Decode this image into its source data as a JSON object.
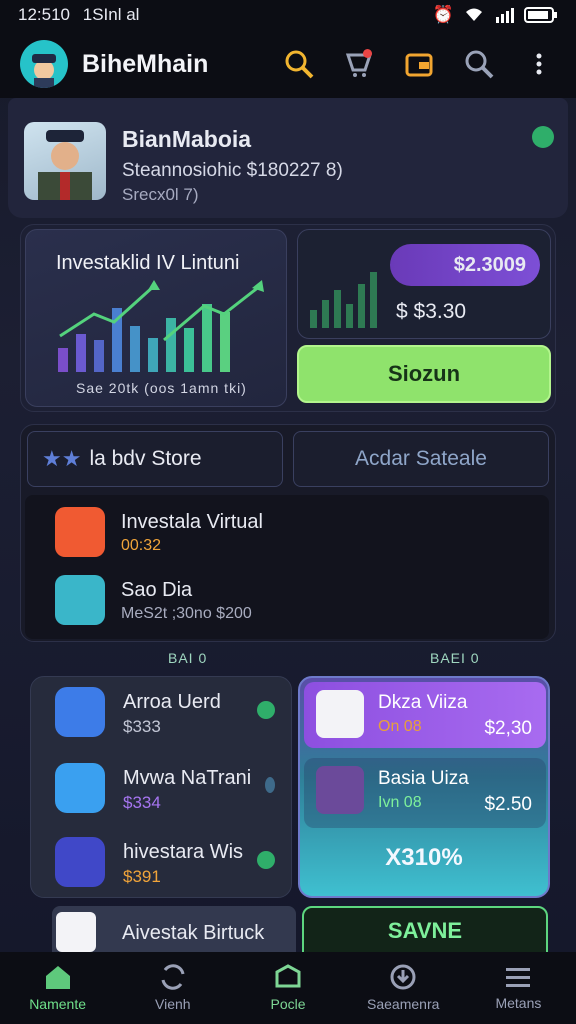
{
  "status_bar": {
    "time": "12:510",
    "carrier": "1SInl al"
  },
  "header": {
    "title": "BiheMhain"
  },
  "profile": {
    "name": "BianMaboia",
    "line1": "Steannosiohic $180227 8)",
    "line2": "Srecx0l 7)"
  },
  "investment": {
    "chart_title": "Investaklid IV Lintuni",
    "chart_caption": "Sae 20tk (oos 1amn tki)",
    "price_badge": "$2.3009",
    "price_sub": "$ $3.30",
    "action_button": "Siozun"
  },
  "store": {
    "tab_left": "la bdv Store",
    "tab_right": "Acdar Sateale",
    "items": [
      {
        "title": "Investala Virtual",
        "sub": "00:32",
        "sub_color": "#f0a43a",
        "icon_color": "#f05a32"
      },
      {
        "title": "Sao Dia",
        "sub": "MeS2t ;30no $200",
        "sub_color": "#a8acbf",
        "icon_color": "#3ab6c9"
      }
    ]
  },
  "section_labels": {
    "left": "BAI 0",
    "right": "BAEI 0"
  },
  "deals": [
    {
      "name": "Arroa Uerd",
      "price": "$333",
      "price_color": "#c3c7d6",
      "icon_color": "#3d7ce8"
    },
    {
      "name": "Mvwa NaTrani",
      "price": "$334",
      "price_color": "#a675f0",
      "icon_color": "#3aa0f0"
    },
    {
      "name": "hivestara Wis",
      "price": "$391",
      "price_color": "#f0a43a",
      "icon_color": "#4048c8"
    }
  ],
  "promos": [
    {
      "name": "Dkza Viiza",
      "code": "On 08",
      "price": "$2,30",
      "code_color": "#e8a03a"
    },
    {
      "name": "Basia Uiza",
      "code": "Ivn 08",
      "price": "$2.50",
      "code_color": "#7ef09b"
    }
  ],
  "promo_percent": "X310%",
  "bottom": {
    "invest_label": "Aivestak Birtuck",
    "save_label": "SAVNE"
  },
  "nav": [
    {
      "label": "Namente",
      "icon": "home-icon",
      "active": true
    },
    {
      "label": "Vienh",
      "icon": "refresh-icon",
      "active": false
    },
    {
      "label": "Pocle",
      "icon": "edit-icon",
      "active": false
    },
    {
      "label": "Saeamenra",
      "icon": "download-icon",
      "active": false
    },
    {
      "label": "Metans",
      "icon": "menu-icon",
      "active": false
    }
  ]
}
